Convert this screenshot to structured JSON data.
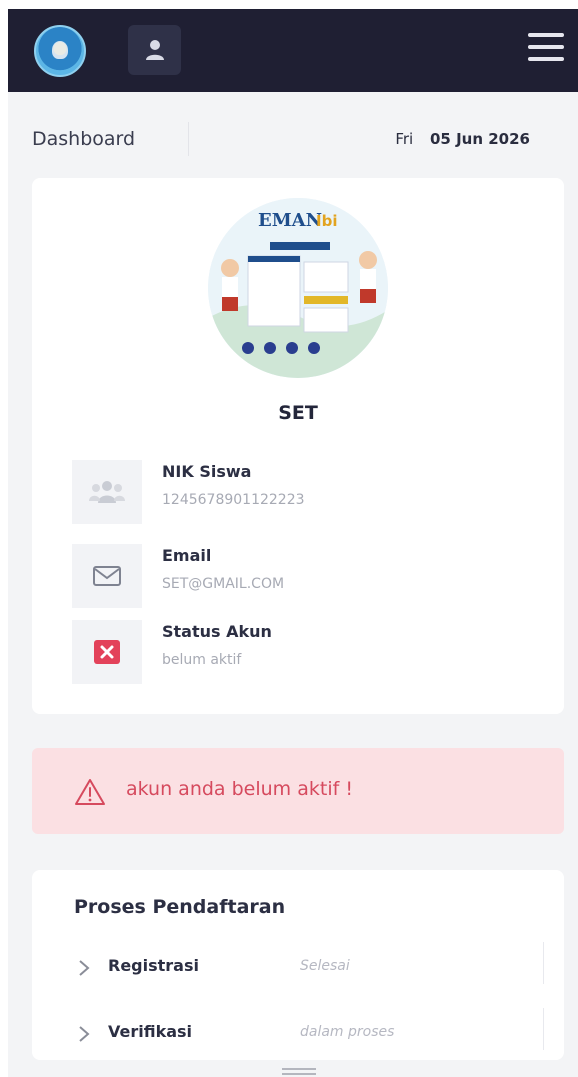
{
  "header": {
    "logo_icon": "tut-wuri-handayani-logo",
    "user_icon": "user-icon",
    "menu_icon": "hamburger-menu-icon"
  },
  "dashboard": {
    "title": "Dashboard",
    "day": "Fri",
    "date": "05 Jun 2026"
  },
  "profile": {
    "image_caption_text": "EMAN",
    "name": "SET",
    "fields": [
      {
        "label": "NIK Siswa",
        "value": "1245678901122223",
        "icon": "users-icon"
      },
      {
        "label": "Email",
        "value": "SET@GMAIL.COM",
        "icon": "envelope-icon"
      },
      {
        "label": "Status Akun",
        "value": "belum aktif",
        "icon": "red-x-icon"
      }
    ]
  },
  "alert": {
    "message": "akun anda belum aktif !",
    "icon": "warning-triangle-icon",
    "color": "#d64a5e"
  },
  "process": {
    "title": "Proses Pendaftaran",
    "steps": [
      {
        "name": "Registrasi",
        "status": "Selesai"
      },
      {
        "name": "Verifikasi",
        "status": "dalam proses"
      }
    ]
  },
  "colors": {
    "topbar": "#1f1f33",
    "page_bg": "#f3f4f6",
    "alert_bg": "#fbe0e3",
    "status_red": "#e3425a"
  }
}
